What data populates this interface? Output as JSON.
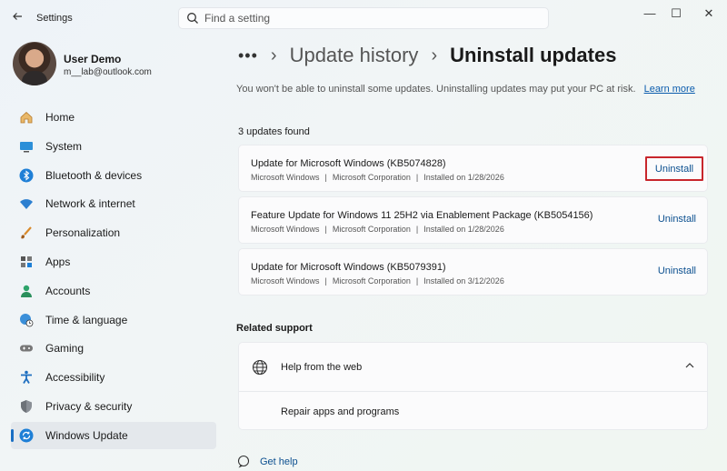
{
  "window": {
    "title": "Settings",
    "controls": {
      "minimize": "—",
      "maximize": "☐",
      "close": "✕"
    }
  },
  "search": {
    "placeholder": "Find a setting"
  },
  "profile": {
    "name": "User Demo",
    "email": "m__lab@outlook.com"
  },
  "sidebar": {
    "items": [
      {
        "label": "Home",
        "icon": "home-icon"
      },
      {
        "label": "System",
        "icon": "system-icon"
      },
      {
        "label": "Bluetooth & devices",
        "icon": "bluetooth-icon"
      },
      {
        "label": "Network & internet",
        "icon": "wifi-icon"
      },
      {
        "label": "Personalization",
        "icon": "brush-icon"
      },
      {
        "label": "Apps",
        "icon": "apps-icon"
      },
      {
        "label": "Accounts",
        "icon": "accounts-icon"
      },
      {
        "label": "Time & language",
        "icon": "globe-clock-icon"
      },
      {
        "label": "Gaming",
        "icon": "gamepad-icon"
      },
      {
        "label": "Accessibility",
        "icon": "accessibility-icon"
      },
      {
        "label": "Privacy & security",
        "icon": "shield-icon"
      },
      {
        "label": "Windows Update",
        "icon": "update-icon",
        "active": true
      }
    ]
  },
  "breadcrumb": {
    "more": "•••",
    "parent": "Update history",
    "current": "Uninstall updates",
    "separator": "›"
  },
  "warning": {
    "text": "You won't be able to uninstall some updates. Uninstalling updates may put your PC at risk.",
    "link": "Learn more"
  },
  "updates": {
    "count_label": "3 updates found",
    "items": [
      {
        "title": "Update for Microsoft Windows (KB5074828)",
        "product": "Microsoft Windows",
        "publisher": "Microsoft Corporation",
        "installed": "Installed on 1/28/2026",
        "action": "Uninstall"
      },
      {
        "title": "Feature Update for Windows 11 25H2 via Enablement Package (KB5054156)",
        "product": "Microsoft Windows",
        "publisher": "Microsoft Corporation",
        "installed": "Installed on 1/28/2026",
        "action": "Uninstall"
      },
      {
        "title": "Update for Microsoft Windows (KB5079391)",
        "product": "Microsoft Windows",
        "publisher": "Microsoft Corporation",
        "installed": "Installed on 3/12/2026",
        "action": "Uninstall"
      }
    ],
    "meta_separator": "|"
  },
  "related": {
    "title": "Related support",
    "help_title": "Help from the web",
    "links": [
      "Repair apps and programs"
    ]
  },
  "footer": {
    "get_help": "Get help"
  },
  "colors": {
    "accent": "#1a6fc4",
    "link": "#0b4f8f",
    "highlight": "#c8262c"
  }
}
